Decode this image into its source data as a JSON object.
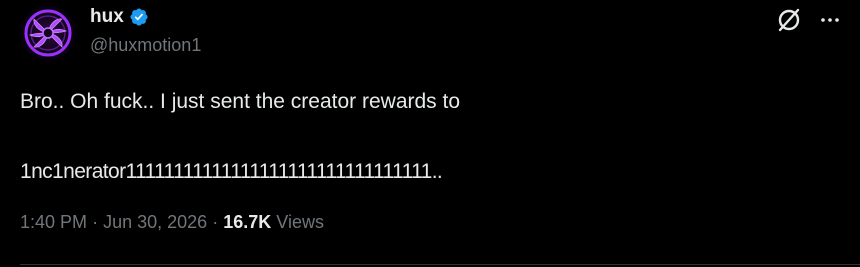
{
  "author": {
    "display_name": "hux",
    "handle": "@huxmotion1",
    "verified": true
  },
  "tweet": {
    "line1": "Bro.. Oh fuck.. I just sent the creator rewards to",
    "line2": "1nc1nerator11111111111111111111111111111111.."
  },
  "meta": {
    "time": "1:40 PM",
    "separator": "·",
    "date": "Jun 30, 2026",
    "views_count": "16.7K",
    "views_label": "Views"
  },
  "icons": {
    "avatar": "avatar-image",
    "verified": "verified-badge-icon",
    "grok": "grok-icon",
    "more": "more-options-icon"
  },
  "colors": {
    "background": "#000000",
    "primary_text": "#e7e9ea",
    "secondary_text": "#71767b",
    "verified_blue": "#1d9bf0",
    "avatar_purple": "#8a2be2",
    "divider": "#2f3336"
  }
}
